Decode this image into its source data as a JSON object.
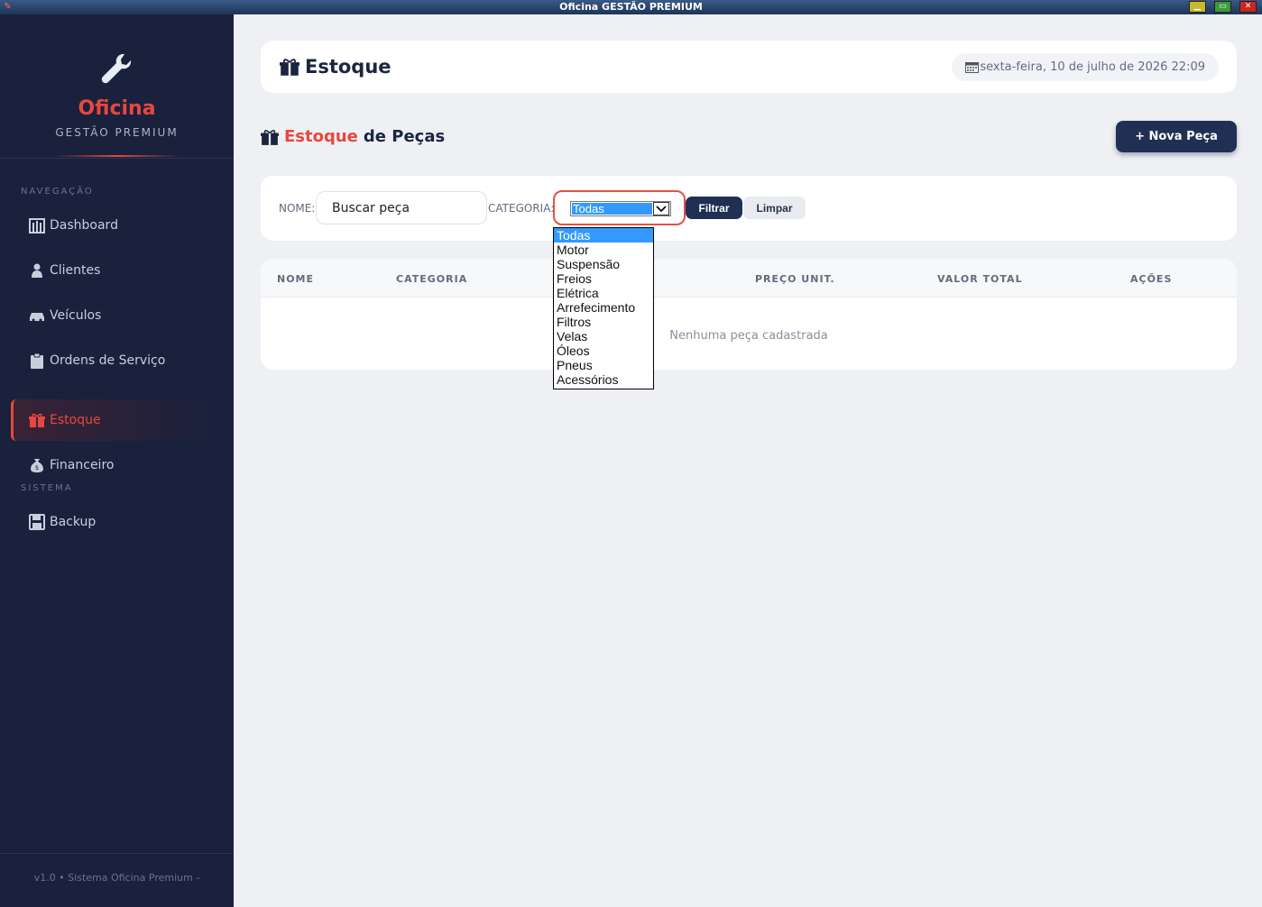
{
  "window": {
    "title": "Oficina GESTÃO PREMIUM"
  },
  "brand": {
    "name": "Oficina",
    "subtitle": "GESTÃO PREMIUM"
  },
  "sidebar": {
    "sections": [
      {
        "label": "NAVEGAÇÃO"
      },
      {
        "label": "SISTEMA"
      }
    ],
    "items": [
      {
        "label": "Dashboard",
        "icon": "dashboard-icon"
      },
      {
        "label": "Clientes",
        "icon": "user-icon"
      },
      {
        "label": "Veículos",
        "icon": "car-icon"
      },
      {
        "label": "Ordens de Serviço",
        "icon": "clipboard-icon"
      },
      {
        "label": "Estoque",
        "icon": "gift-box-icon",
        "active": true
      },
      {
        "label": "Financeiro",
        "icon": "money-bag-icon"
      },
      {
        "label": "Backup",
        "icon": "floppy-disk-icon"
      }
    ],
    "footer": "v1.0 • Sistema Oficina Premium -"
  },
  "header": {
    "title": "Estoque",
    "date": "sexta-feira, 10 de julho de 2026 22:09"
  },
  "section": {
    "title_accent": "Estoque",
    "title_rest": "de Peças",
    "new_button": "+ Nova Peça"
  },
  "filters": {
    "name_label": "NOME:",
    "name_placeholder": "Buscar peça",
    "category_label": "CATEGORIA:",
    "category_selected": "Todas",
    "filter_button": "Filtrar",
    "clear_button": "Limpar"
  },
  "table": {
    "columns": [
      "NOME",
      "CATEGORIA",
      "PREÇO UNIT.",
      "VALOR TOTAL",
      "AÇÕES"
    ],
    "empty_message": "Nenhuma peça cadastrada"
  },
  "dropdown": {
    "options": [
      "Todas",
      "Motor",
      "Suspensão",
      "Freios",
      "Elétrica",
      "Arrefecimento",
      "Filtros",
      "Velas",
      "Óleos",
      "Pneus",
      "Acessórios"
    ]
  },
  "colors": {
    "accent": "#e8473e",
    "sidebar": "#19213d",
    "primary": "#1f3054",
    "selection": "#3399ff"
  }
}
